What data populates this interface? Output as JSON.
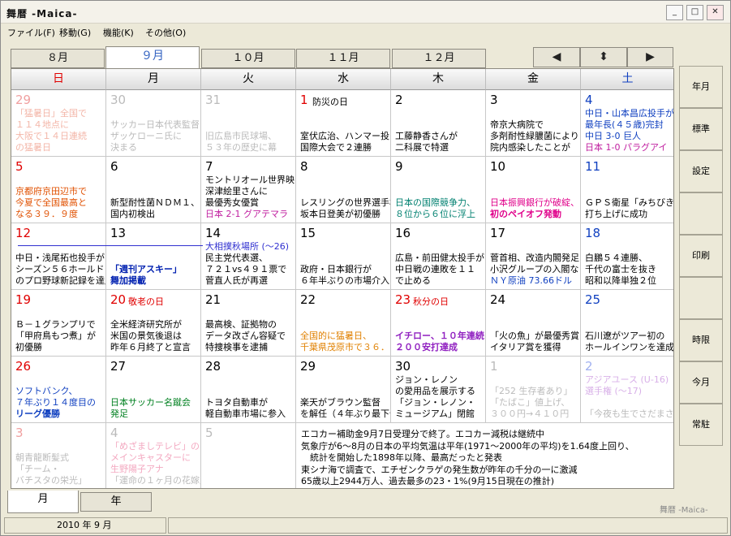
{
  "window": {
    "title": "舞暦 -Maica-",
    "min": "_",
    "max": "□",
    "close": "✕"
  },
  "menu": [
    "ファイル(F)",
    "移動(G)",
    "機能(K)",
    "その他(O)"
  ],
  "month_tabs": [
    "８月",
    "９月",
    "１０月",
    "１１月",
    "１２月"
  ],
  "nav": {
    "prev": "◀",
    "updown": "⬍",
    "next": "▶"
  },
  "dow": [
    "日",
    "月",
    "火",
    "水",
    "木",
    "金",
    "土"
  ],
  "weeks": [
    [
      {
        "day": "29",
        "out": true,
        "events": [
          [
            "「猛暑日」全国で",
            "#f3b6a8"
          ],
          [
            "１１４地点に",
            "#f3b6a8"
          ],
          [
            "大阪で１４日連続",
            "#f3b6a8"
          ],
          [
            "の猛暑日",
            "#f3b6a8"
          ]
        ]
      },
      {
        "day": "30",
        "out": true,
        "events": [
          [
            "",
            "#bbb"
          ],
          [
            "サッカー日本代表監督",
            "#bbb"
          ],
          [
            "ザッケローニ氏に",
            "#bbb"
          ],
          [
            "決まる",
            "#bbb"
          ]
        ]
      },
      {
        "day": "31",
        "out": true,
        "events": [
          [
            "",
            "#bbb"
          ],
          [
            "",
            "#bbb"
          ],
          [
            "旧広島市民球場、",
            "#bbb"
          ],
          [
            "５３年の歴史に幕",
            "#bbb"
          ]
        ]
      },
      {
        "day": "1",
        "hol": "防災の日",
        "events": [
          [
            "",
            "#000"
          ],
          [
            "",
            "#000"
          ],
          [
            "室伏広治、ハンマー投げ",
            "#000"
          ],
          [
            "国際大会で２連勝",
            "#000"
          ]
        ]
      },
      {
        "day": "2",
        "events": [
          [
            "",
            "#000"
          ],
          [
            "",
            "#000"
          ],
          [
            "工藤静香さんが",
            "#000"
          ],
          [
            "二科展で特選",
            "#000"
          ]
        ]
      },
      {
        "day": "3",
        "events": [
          [
            "",
            "#000"
          ],
          [
            "帝京大病院で",
            "#000"
          ],
          [
            "多剤耐性緑膿菌により",
            "#000"
          ],
          [
            "院内感染したことが",
            "#000"
          ]
        ]
      },
      {
        "day": "4",
        "events": [
          [
            "中日・山本昌広投手が",
            "#1040c0"
          ],
          [
            "最年長(４５歳)完封",
            "#1040c0"
          ],
          [
            "中日 3-0 巨人",
            "#1040c0"
          ],
          [
            "日本 1-0 パラグアイ",
            "#c020a0"
          ]
        ]
      }
    ],
    [
      {
        "day": "5",
        "events": [
          [
            "",
            "#000"
          ],
          [
            "京都府京田辺市で",
            "#e05000"
          ],
          [
            "今夏で全国最高と",
            "#e05000"
          ],
          [
            "なる３９．９度",
            "#e05000"
          ]
        ]
      },
      {
        "day": "6",
        "events": [
          [
            "",
            "#000"
          ],
          [
            "",
            "#000"
          ],
          [
            "新型耐性菌ＮＤＭ１、",
            "#000"
          ],
          [
            "国内初検出",
            "#000"
          ]
        ]
      },
      {
        "day": "7",
        "events": [
          [
            "モントリオール世界映画祭",
            "#000"
          ],
          [
            "深津絵里さんに",
            "#000"
          ],
          [
            "最優秀女優賞",
            "#000"
          ],
          [
            "日本 2-1 グアテマラ",
            "#c020a0"
          ]
        ]
      },
      {
        "day": "8",
        "events": [
          [
            "",
            "#000"
          ],
          [
            "",
            "#000"
          ],
          [
            "レスリングの世界選手権",
            "#000"
          ],
          [
            "坂本日登美が初優勝",
            "#000"
          ]
        ]
      },
      {
        "day": "9",
        "events": [
          [
            "",
            "#000"
          ],
          [
            "",
            "#000"
          ],
          [
            "日本の国際競争力、",
            "#008070"
          ],
          [
            "８位から６位に浮上",
            "#008070"
          ]
        ]
      },
      {
        "day": "10",
        "events": [
          [
            "",
            "#000"
          ],
          [
            "",
            "#000"
          ],
          [
            "日本振興銀行が破綻、",
            "#e0008a"
          ],
          [
            "初のペイオフ発動",
            "#e0008a",
            "b"
          ]
        ]
      },
      {
        "day": "11",
        "events": [
          [
            "",
            "#000"
          ],
          [
            "",
            "#000"
          ],
          [
            "ＧＰＳ衛星「みちびき」",
            "#000"
          ],
          [
            "打ち上げに成功",
            "#000"
          ]
        ]
      }
    ],
    [
      {
        "day": "12",
        "events": [
          [
            "",
            "#000"
          ],
          [
            "中日・浅尾拓也投手が",
            "#000"
          ],
          [
            "シーズン５６ホールド",
            "#000"
          ],
          [
            "のプロ野球新記録を達成",
            "#000"
          ]
        ]
      },
      {
        "day": "13",
        "events": [
          [
            "",
            "#000"
          ],
          [
            "",
            "#000"
          ],
          [
            "「週刊アスキー」",
            "#0020b0",
            "b"
          ],
          [
            "舞加掲載",
            "#0020b0",
            "b"
          ]
        ]
      },
      {
        "day": "14",
        "events": [
          [
            "大相撲秋場所 (～26)",
            "#3030d0"
          ],
          [
            "民主党代表選、",
            "#000"
          ],
          [
            "７２１vs４９１票で",
            "#000"
          ],
          [
            "菅直人氏が再選",
            "#000"
          ]
        ]
      },
      {
        "day": "15",
        "events": [
          [
            "",
            "#000"
          ],
          [
            "",
            "#000"
          ],
          [
            "政府・日本銀行が",
            "#000"
          ],
          [
            "６年半ぶりの市場介入",
            "#000"
          ]
        ]
      },
      {
        "day": "16",
        "events": [
          [
            "",
            "#000"
          ],
          [
            "広島・前田健太投手が",
            "#000"
          ],
          [
            "中日戦の連敗を１１",
            "#000"
          ],
          [
            "で止める",
            "#000"
          ]
        ]
      },
      {
        "day": "17",
        "events": [
          [
            "",
            "#000"
          ],
          [
            "菅首相、改造内閣発足",
            "#000"
          ],
          [
            "小沢グループの入閣なし",
            "#000"
          ],
          [
            "ＮＹ原油 73.66ドル",
            "#1040c0"
          ]
        ]
      },
      {
        "day": "18",
        "events": [
          [
            "",
            "#000"
          ],
          [
            "白鵬５４連勝、",
            "#000"
          ],
          [
            "千代の富士を抜き",
            "#000"
          ],
          [
            "昭和以降単独２位",
            "#000"
          ]
        ]
      }
    ],
    [
      {
        "day": "19",
        "events": [
          [
            "",
            "#000"
          ],
          [
            "Ｂ－１グランプリで",
            "#000"
          ],
          [
            "「甲府鳥もつ煮」が",
            "#000"
          ],
          [
            "初優勝",
            "#000"
          ]
        ]
      },
      {
        "day": "20",
        "hol": "敬老の日",
        "events": [
          [
            "",
            "#000"
          ],
          [
            "全米経済研究所が",
            "#000"
          ],
          [
            "米国の景気後退は",
            "#000"
          ],
          [
            "昨年６月終了と宣言",
            "#000"
          ]
        ]
      },
      {
        "day": "21",
        "events": [
          [
            "",
            "#000"
          ],
          [
            "最高検、証拠物の",
            "#000"
          ],
          [
            "データ改ざん容疑で",
            "#000"
          ],
          [
            "特捜検事を逮捕",
            "#000"
          ]
        ]
      },
      {
        "day": "22",
        "events": [
          [
            "",
            "#000"
          ],
          [
            "",
            "#000"
          ],
          [
            "全国的に猛暑日、",
            "#e08000"
          ],
          [
            "千葉県茂原市で３６．５度",
            "#e08000"
          ]
        ]
      },
      {
        "day": "23",
        "hol": "秋分の日",
        "events": [
          [
            "",
            "#000"
          ],
          [
            "",
            "#000"
          ],
          [
            "イチロー、１０年連続",
            "#9020c0",
            "b"
          ],
          [
            "２００安打達成",
            "#9020c0",
            "b"
          ]
        ]
      },
      {
        "day": "24",
        "events": [
          [
            "",
            "#000"
          ],
          [
            "",
            "#000"
          ],
          [
            "「火の魚」が最優秀賞",
            "#000"
          ],
          [
            "イタリア賞を獲得",
            "#000"
          ]
        ]
      },
      {
        "day": "25",
        "events": [
          [
            "",
            "#000"
          ],
          [
            "",
            "#000"
          ],
          [
            "石川遼がツアー初の",
            "#000"
          ],
          [
            "ホールインワンを達成",
            "#000"
          ]
        ]
      }
    ],
    [
      {
        "day": "26",
        "events": [
          [
            "",
            "#000"
          ],
          [
            "ソフトバンク、",
            "#1040c0"
          ],
          [
            "７年ぶり１４度目の",
            "#1040c0"
          ],
          [
            "リーグ優勝",
            "#1040c0",
            "b"
          ]
        ]
      },
      {
        "day": "27",
        "events": [
          [
            "",
            "#000"
          ],
          [
            "",
            "#000"
          ],
          [
            "日本サッカー名蹴会",
            "#008020"
          ],
          [
            "発足",
            "#008020"
          ]
        ]
      },
      {
        "day": "28",
        "events": [
          [
            "",
            "#000"
          ],
          [
            "",
            "#000"
          ],
          [
            "トヨタ自動車が",
            "#000"
          ],
          [
            "軽自動車市場に参入",
            "#000"
          ]
        ]
      },
      {
        "day": "29",
        "events": [
          [
            "",
            "#000"
          ],
          [
            "",
            "#000"
          ],
          [
            "楽天がブラウン監督",
            "#000"
          ],
          [
            "を解任（４年ぶり最下位）",
            "#000"
          ]
        ]
      },
      {
        "day": "30",
        "events": [
          [
            "ジョン・レノン",
            "#000"
          ],
          [
            "の愛用品を展示する",
            "#000"
          ],
          [
            "「ジョン・レノン・",
            "#000"
          ],
          [
            "ミュージアム」閉館",
            "#000"
          ]
        ]
      },
      {
        "day": "1",
        "out": true,
        "events": [
          [
            "",
            "#bbb"
          ],
          [
            "「252 生存者あり」",
            "#bbb"
          ],
          [
            "「たばこ」値上げ、",
            "#bbb"
          ],
          [
            "３００円→４１０円",
            "#bbb"
          ]
        ]
      },
      {
        "day": "2",
        "out": true,
        "events": [
          [
            "アジアユース (U-16)",
            "#d8b0e8"
          ],
          [
            "選手権 (～17)",
            "#d8b0e8"
          ],
          [
            "",
            "#bbb"
          ],
          [
            "「今夜も生でさだまさし」",
            "#bbb"
          ]
        ]
      }
    ],
    [
      {
        "day": "3",
        "out": true,
        "events": [
          [
            "",
            "#bbb"
          ],
          [
            "朝青龍断髪式",
            "#bbb"
          ],
          [
            "「チーム・",
            "#bbb"
          ],
          [
            "バチスタの栄光」",
            "#bbb"
          ]
        ]
      },
      {
        "day": "4",
        "out": true,
        "events": [
          [
            "「めざましテレビ」の",
            "#f3a8c0"
          ],
          [
            "メインキャスターに",
            "#f3a8c0"
          ],
          [
            "生野陽子アナ",
            "#f3a8c0"
          ],
          [
            "「運命の１ヶ月の花嫁」",
            "#bbb"
          ]
        ]
      },
      {
        "day": "5",
        "out": true,
        "events": []
      }
    ]
  ],
  "notes": [
    "エコカー補助金9月7日受理分で終了。エコカー減税は継続中",
    "気象庁が6～8月の日本の平均気温は平年(1971～2000年の平均)を1.64度上回り、",
    "　統計を開始した1898年以降、最高だったと発表",
    "東シナ海で調査で、エチゼンクラゲの発生数が昨年の千分の一に激減",
    "65歳以上2944万人、過去最多の23・1%(9月15日現在の推計)"
  ],
  "sumo_line": "大相撲秋場所 (～26)",
  "right_buttons": [
    "年月",
    "標準",
    "設定",
    "",
    "印刷",
    "",
    "時限",
    "今月",
    "常駐"
  ],
  "bottom_tabs": [
    "月",
    "年"
  ],
  "brand": "舞暦 -Maica-",
  "status": "2010 年 9 月",
  "colors": {
    "sunday": "#e00000",
    "saturday": "#1040c0",
    "holiday": "#e00000",
    "outside": "#bbbbbb"
  }
}
